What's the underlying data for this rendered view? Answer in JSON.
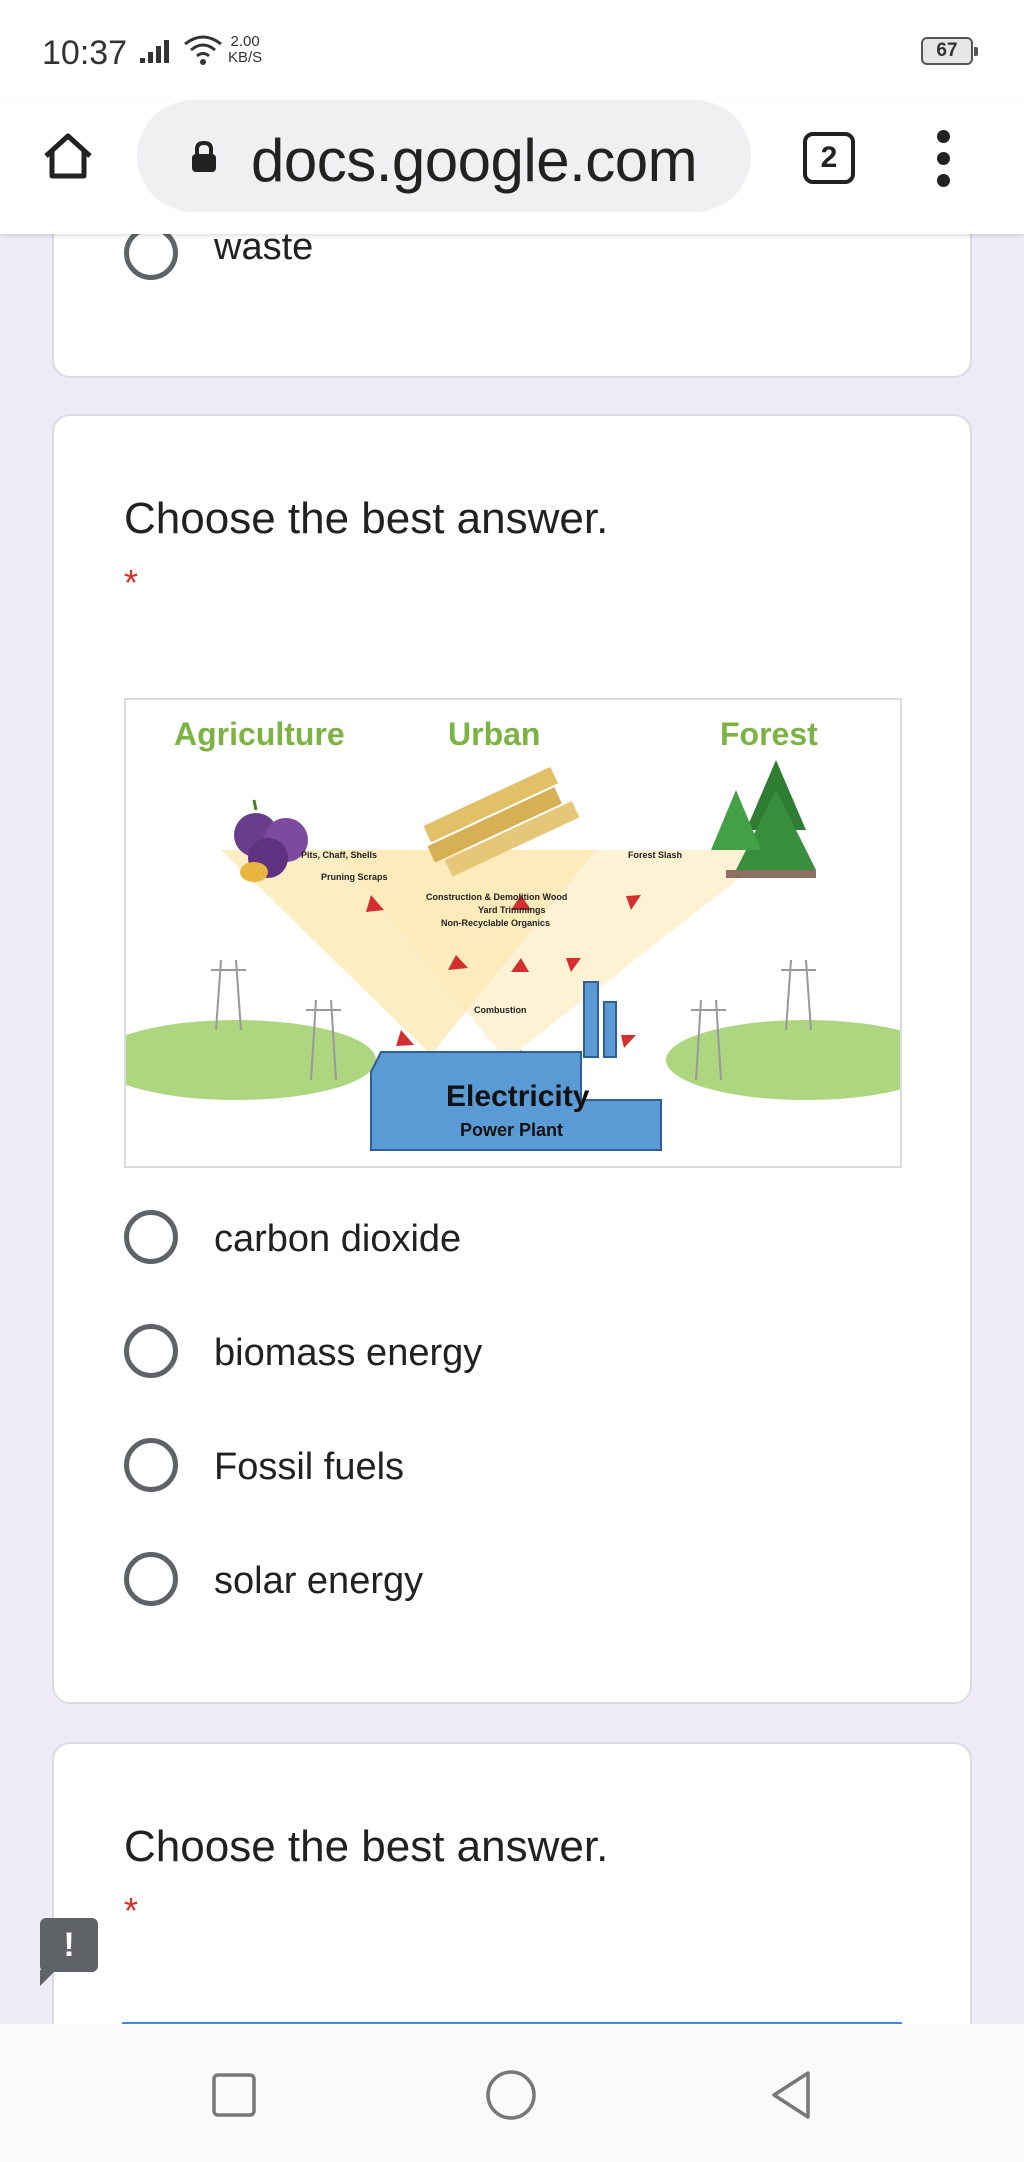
{
  "status_bar": {
    "time": "10:37",
    "speed_value": "2.00",
    "speed_unit": "KB/S",
    "battery": "67"
  },
  "browser": {
    "url": "docs.google.com",
    "tab_count": "2",
    "icons": [
      "home-icon",
      "lock-icon",
      "tabs-icon",
      "more-vert-icon"
    ]
  },
  "previous_question": {
    "option_label": "waste"
  },
  "question": {
    "title": "Choose the best answer.",
    "required_mark": "*",
    "figure": {
      "labels": {
        "agriculture": "Agriculture",
        "urban": "Urban",
        "forest": "Forest",
        "pits": "Pits, Chaff, Shells",
        "pruning": "Pruning Scraps",
        "construction": "Construction & Demolition Wood",
        "yard": "Yard Trimmings",
        "non_recyclable": "Non-Recyclable Organics",
        "forest_slash": "Forest Slash",
        "combustion": "Combustion",
        "electricity": "Electricity",
        "power_plant": "Power Plant"
      }
    },
    "options": [
      {
        "label": "carbon dioxide"
      },
      {
        "label": "biomass energy"
      },
      {
        "label": "Fossil fuels"
      },
      {
        "label": "solar energy"
      }
    ]
  },
  "next_question": {
    "title": "Choose the best answer.",
    "required_mark": "*"
  },
  "feedback_button": {
    "label": "!"
  },
  "colors": {
    "page_background": "#eeebf6",
    "required": "#d93025",
    "figure_label_green": "#7cb342",
    "power_plant_blue": "#5b9bd5"
  }
}
